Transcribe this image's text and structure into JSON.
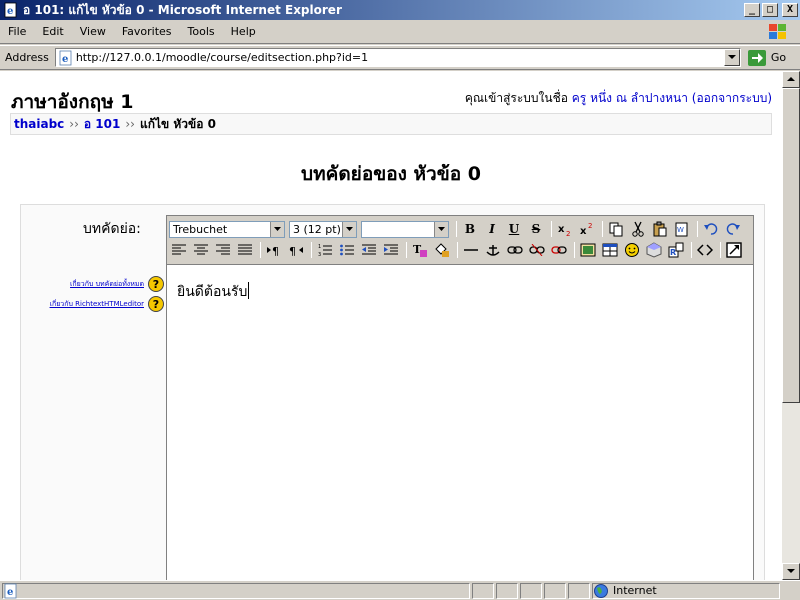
{
  "window": {
    "title": "อ 101: แก้ไข หัวข้อ 0 - Microsoft Internet Explorer",
    "min_label": "_",
    "max_label": "□",
    "close_label": "X"
  },
  "menu": [
    "File",
    "Edit",
    "View",
    "Favorites",
    "Tools",
    "Help"
  ],
  "address": {
    "label": "Address",
    "url": "http://127.0.0.1/moodle/course/editsection.php?id=1",
    "go_label": "Go"
  },
  "page": {
    "course_title": "ภาษาอังกฤษ 1",
    "login_prefix": "คุณเข้าสู่ระบบในชื่อ",
    "user_name": "ครู หนึ่ง ณ ลำปางหนา",
    "logout_link": "(ออกจากระบบ)",
    "breadcrumb": [
      {
        "label": "thaiabc",
        "link": true
      },
      {
        "label": "อ 101",
        "link": true
      },
      {
        "label": "แก้ไข หัวข้อ 0",
        "link": false
      }
    ],
    "breadcrumb_sep": "››",
    "heading": "บทคัดย่อของ หัวข้อ 0",
    "summary_label": "บทคัดย่อ:",
    "help_links": [
      "เกี่ยวกับ บทคัดย่อทั้งหมด",
      "เกี่ยวกับ RichtextHTMLeditor"
    ],
    "help_icon": "?"
  },
  "editor": {
    "font_value": "Trebuchet",
    "size_value": "3 (12 pt)",
    "style_value": "",
    "bold": "B",
    "italic": "I",
    "underline": "U",
    "strike": "S",
    "content": "ยินดีต้อนรับ"
  },
  "status": {
    "zone": "Internet"
  },
  "colors": {
    "titlebar_start": "#0a246a",
    "titlebar_end": "#a6caf0",
    "link": "#0000cc",
    "chrome": "#d4d0c8"
  }
}
